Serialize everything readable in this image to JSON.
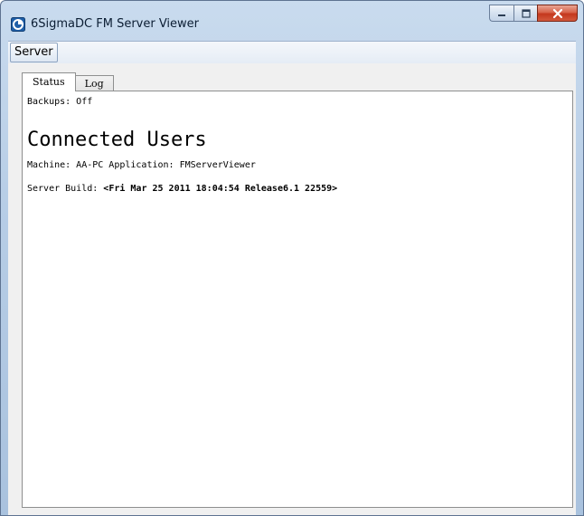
{
  "window": {
    "title": "6SigmaDC FM Server Viewer",
    "icon": "app-logo-icon",
    "controls": [
      "minimize-icon",
      "maximize-icon",
      "close-icon"
    ]
  },
  "menu": {
    "items": [
      {
        "label": "Server"
      }
    ]
  },
  "tabs": [
    {
      "label": "Status",
      "active": true
    },
    {
      "label": "Log",
      "active": false
    }
  ],
  "status": {
    "backups": "Backups: Off",
    "heading": "Connected Users",
    "machine": "Machine: AA-PC Application: FMServerViewer",
    "server_build_prefix": "Server Build: ",
    "server_build_value": "<Fri Mar 25 2011 18:04:54 Release6.1 22559>"
  }
}
